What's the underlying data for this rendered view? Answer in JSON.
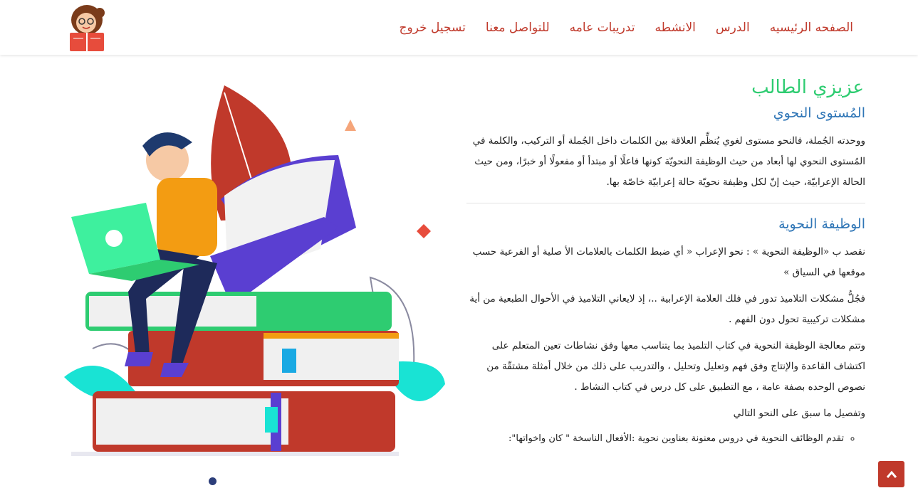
{
  "nav": {
    "items": [
      {
        "label": "الصفحه الرئيسيه"
      },
      {
        "label": "الدرس"
      },
      {
        "label": "الانشطه"
      },
      {
        "label": "تدريبات عامه"
      },
      {
        "label": "للتواصل معنا"
      },
      {
        "label": "تسجيل خروج"
      }
    ],
    "accent": "#c0392b"
  },
  "content": {
    "greeting": "عزيزي الطالب",
    "section1_title": "المُستوى النحوي",
    "section1_text": "ووحدته الجُملة، فالنحو مستوى لغوي يُنظِّم العلاقة بين الكلمات داخل الجُملة أو التركيب، والكلمة في المُستوى النحوي لها أبعاد من حيث الوظيفة النحويّة كونها فاعلًا أو مبتدأ أو مفعولًا أو خبرًا، ومن حيث الحالة الإعرابيّة، حيث إنّ لكل وظيفة نحويّة حالة إعرابيّة خاصّة بها.",
    "section2_title": "الوظيفة النحوية",
    "p1": "نقصد ب «الوظيفة النحوية » : نحو الإعراب « أي ضبط الكلمات بالعلامات الأ صلية أو الفرعية حسب موقعها في السياق »",
    "p2": "فجُلُّ مشكلات التلاميذ تدور في فلك العلامة الإعرابية ..، إذ لايعاني التلاميذ في الأحوال الطبعية من أية مشكلات تركيبية تحول دون الفهم .",
    "p3": "وتتم معالجة الوظيفة النحوية في كتاب التلميذ بما يتناسب معها وفق نشاطات تعين المتعلم على اكتشاف القاعدة والإنتاج وفق فهم وتعليل وتحليل ، والتدريب على ذلك من خلال أمثلة مشتقّة من نصوص الوحده بصفة عامة ، مع التطبيق على كل درس في كتاب النشاط .",
    "p4": "وتفصيل ما سبق على النحو التالي",
    "bullets": [
      "تقدم الوظائف النحوية في دروس معنونة بعناوين نحوية :الأفعال الناسخة \" كان واخواتها\":"
    ],
    "colors": {
      "heading": "#2ecc71",
      "subheading": "#2e75b6"
    }
  },
  "icons": {
    "logo": "reading-girl-logo",
    "scroll_top": "chevron-up-icon"
  }
}
